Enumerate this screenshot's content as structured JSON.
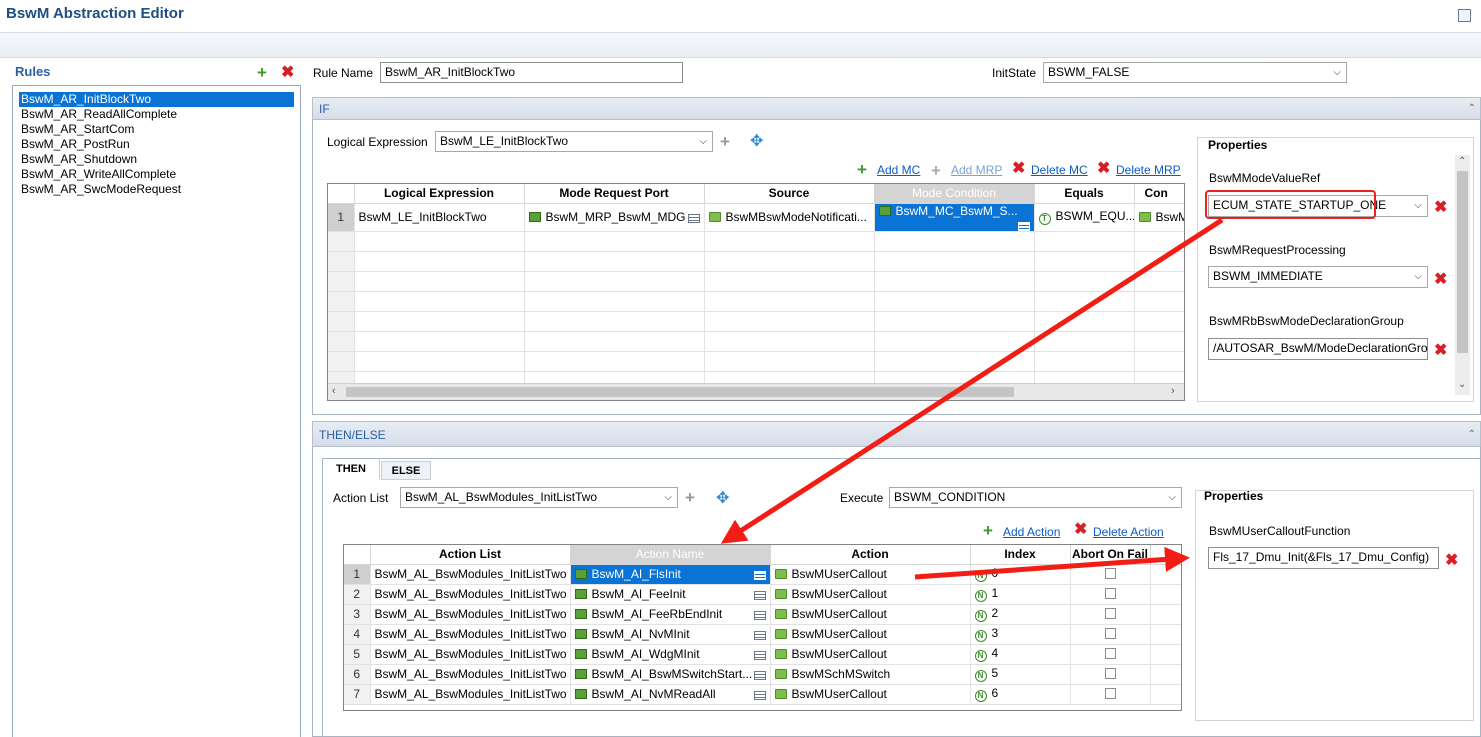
{
  "editor": {
    "title": "BswM Abstraction Editor"
  },
  "rules": {
    "title": "Rules",
    "items": [
      "BswM_AR_InitBlockTwo",
      "BswM_AR_ReadAllComplete",
      "BswM_AR_StartCom",
      "BswM_AR_PostRun",
      "BswM_AR_Shutdown",
      "BswM_AR_WriteAllComplete",
      "BswM_AR_SwcModeRequest"
    ],
    "selected_index": 0
  },
  "rule": {
    "name_label": "Rule Name",
    "name_value": "BswM_AR_InitBlockTwo",
    "initstate_label": "InitState",
    "initstate_value": "BSWM_FALSE"
  },
  "if_section": {
    "title": "IF",
    "logical_expression_label": "Logical Expression",
    "logical_expression_value": "BswM_LE_InitBlockTwo",
    "actions": {
      "add_mc": "Add MC",
      "add_mrp": "Add MRP",
      "delete_mc": "Delete MC",
      "delete_mrp": "Delete MRP"
    },
    "grid": {
      "headers": [
        "Logical Expression",
        "Mode Request Port",
        "Source",
        "Mode Condition",
        "Equals",
        "Con"
      ],
      "rows": [
        {
          "num": "1",
          "cells": [
            "BswM_LE_InitBlockTwo",
            "BswM_MRP_BswM_MDG",
            "BswMBswModeNotificati...",
            "BswM_MC_BswM_S...",
            "BSWM_EQU...",
            "BswM"
          ]
        }
      ]
    },
    "properties": {
      "title": "Properties",
      "fields": [
        {
          "label": "BswMModeValueRef",
          "value": "ECUM_STATE_STARTUP_ONE"
        },
        {
          "label": "BswMRequestProcessing",
          "value": "BSWM_IMMEDIATE"
        },
        {
          "label": "BswMRbBswModeDeclarationGroup",
          "value": "/AUTOSAR_BswM/ModeDeclarationGrou"
        }
      ]
    }
  },
  "then_else": {
    "title": "THEN/ELSE",
    "tabs": [
      "THEN",
      "ELSE"
    ],
    "action_list_label": "Action List",
    "action_list_value": "BswM_AL_BswModules_InitListTwo",
    "execute_label": "Execute",
    "execute_value": "BSWM_CONDITION",
    "actions": {
      "add_action": "Add Action",
      "delete_action": "Delete Action"
    },
    "grid": {
      "headers": [
        "Action List",
        "Action Name",
        "Action",
        "Index",
        "Abort On Fail"
      ],
      "rows": [
        {
          "num": "1",
          "list": "BswM_AL_BswModules_InitListTwo",
          "name": "BswM_AI_FlsInit",
          "action": "BswMUserCallout",
          "index": "0"
        },
        {
          "num": "2",
          "list": "BswM_AL_BswModules_InitListTwo",
          "name": "BswM_AI_FeeInit",
          "action": "BswMUserCallout",
          "index": "1"
        },
        {
          "num": "3",
          "list": "BswM_AL_BswModules_InitListTwo",
          "name": "BswM_AI_FeeRbEndInit",
          "action": "BswMUserCallout",
          "index": "2"
        },
        {
          "num": "4",
          "list": "BswM_AL_BswModules_InitListTwo",
          "name": "BswM_AI_NvMInit",
          "action": "BswMUserCallout",
          "index": "3"
        },
        {
          "num": "5",
          "list": "BswM_AL_BswModules_InitListTwo",
          "name": "BswM_AI_WdgMInit",
          "action": "BswMUserCallout",
          "index": "4"
        },
        {
          "num": "6",
          "list": "BswM_AL_BswModules_InitListTwo",
          "name": "BswM_AI_BswMSwitchStart...",
          "action": "BswMSchMSwitch",
          "index": "5"
        },
        {
          "num": "7",
          "list": "BswM_AL_BswModules_InitListTwo",
          "name": "BswM_AI_NvMReadAll",
          "action": "BswMUserCallout",
          "index": "6"
        }
      ]
    },
    "properties": {
      "title": "Properties",
      "fields": [
        {
          "label": "BswMUserCalloutFunction",
          "value": "Fls_17_Dmu_Init(&Fls_17_Dmu_Config)"
        }
      ]
    }
  },
  "colors": {
    "accent": "#0a74d6",
    "highlight_border": "#e8231c",
    "arrow": "#f21d14",
    "title": "#1f4f82"
  }
}
